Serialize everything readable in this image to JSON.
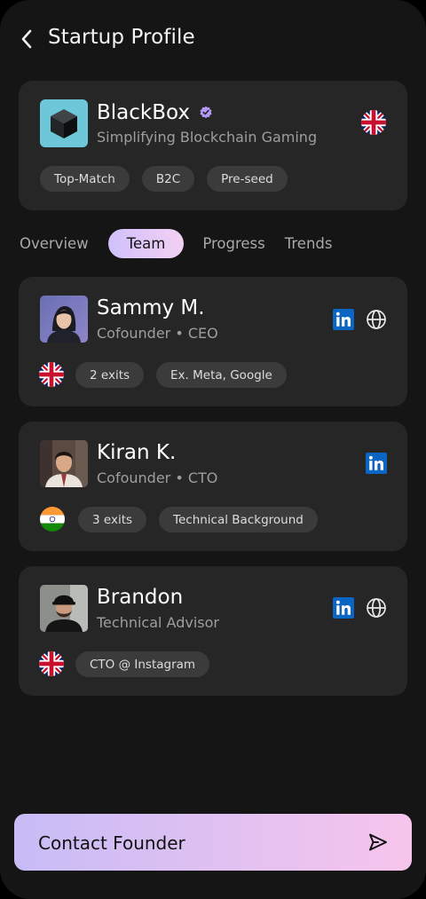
{
  "header": {
    "title": "Startup Profile"
  },
  "startup": {
    "name": "BlackBox",
    "tagline": "Simplifying Blockchain Gaming",
    "country": "UK",
    "tags": [
      "Top-Match",
      "B2C",
      "Pre-seed"
    ]
  },
  "tabs": [
    {
      "label": "Overview",
      "active": false
    },
    {
      "label": "Team",
      "active": true
    },
    {
      "label": "Progress",
      "active": false
    },
    {
      "label": "Trends",
      "active": false
    }
  ],
  "team": [
    {
      "name": "Sammy M.",
      "role": "Cofounder • CEO",
      "country": "UK",
      "tags": [
        "2 exits",
        "Ex. Meta, Google"
      ],
      "links": [
        "linkedin",
        "website"
      ]
    },
    {
      "name": "Kiran K.",
      "role": "Cofounder • CTO",
      "country": "India",
      "tags": [
        "3 exits",
        "Technical Background"
      ],
      "links": [
        "linkedin"
      ]
    },
    {
      "name": "Brandon",
      "role": "Technical Advisor",
      "country": "UK",
      "tags": [
        "CTO @ Instagram"
      ],
      "links": [
        "linkedin",
        "website"
      ]
    }
  ],
  "cta": {
    "label": "Contact Founder"
  },
  "colors": {
    "accent_start": "#c7bcf6",
    "accent_end": "#f7c5ec",
    "card": "#262626",
    "background": "#151515",
    "chip": "#3b3b3b"
  }
}
